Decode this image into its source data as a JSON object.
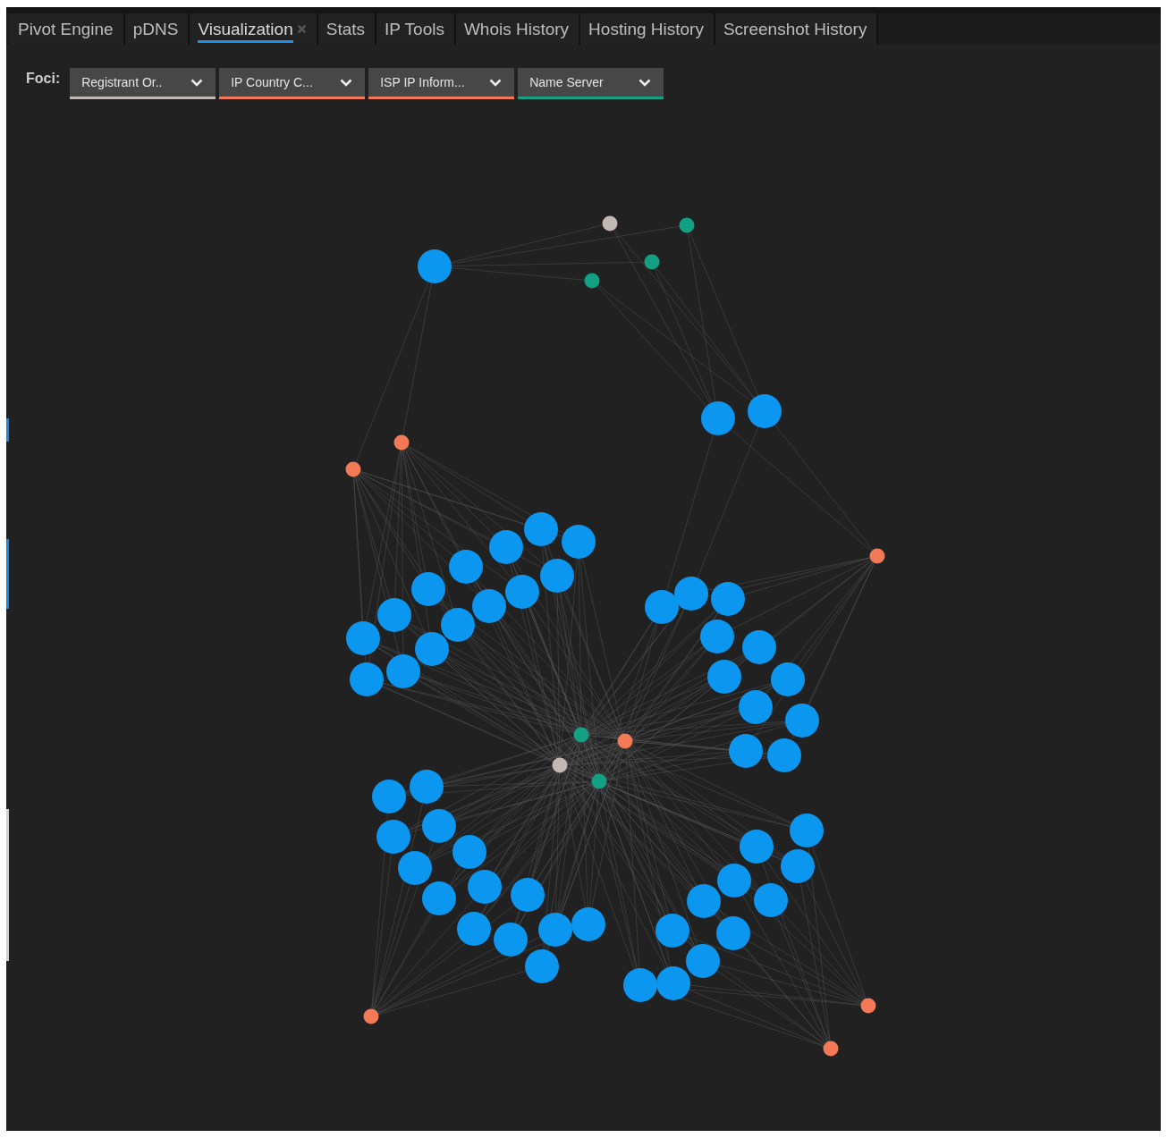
{
  "tabs": [
    {
      "label": "Pivot Engine",
      "selected": false,
      "closable": false
    },
    {
      "label": "pDNS",
      "selected": false,
      "closable": false
    },
    {
      "label": "Visualization",
      "selected": true,
      "closable": true
    },
    {
      "label": "Stats",
      "selected": false,
      "closable": false
    },
    {
      "label": "IP Tools",
      "selected": false,
      "closable": false
    },
    {
      "label": "Whois History",
      "selected": false,
      "closable": false
    },
    {
      "label": "Hosting History",
      "selected": false,
      "closable": false
    },
    {
      "label": "Screenshot History",
      "selected": false,
      "closable": false
    }
  ],
  "foci": {
    "label": "Foci:",
    "items": [
      {
        "value": "Registrant Or..",
        "color": "#c4b8b4"
      },
      {
        "value": "IP Country C...",
        "color": "#f47a57"
      },
      {
        "value": "ISP IP Inform...",
        "color": "#f47a57"
      },
      {
        "value": "Name Server",
        "color": "#12a083"
      }
    ]
  }
}
